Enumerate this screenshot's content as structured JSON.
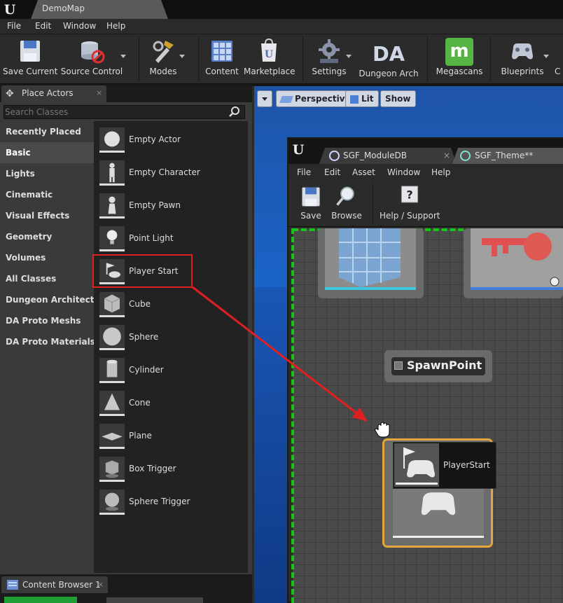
{
  "window": {
    "tab_title": "DemoMap"
  },
  "menu": {
    "items": [
      "File",
      "Edit",
      "Window",
      "Help"
    ]
  },
  "toolbar": {
    "buttons": [
      {
        "label": "Save Current",
        "icon": "save-icon"
      },
      {
        "label": "Source Control",
        "icon": "source-control-icon"
      },
      {
        "label": "Modes",
        "icon": "modes-icon"
      },
      {
        "label": "Content",
        "icon": "content-icon"
      },
      {
        "label": "Marketplace",
        "icon": "marketplace-icon"
      },
      {
        "label": "Settings",
        "icon": "settings-icon"
      },
      {
        "label": "Dungeon Arch",
        "icon": "dungeon-arch-icon"
      },
      {
        "label": "Megascans",
        "icon": "megascans-icon"
      },
      {
        "label": "Blueprints",
        "icon": "blueprints-icon"
      },
      {
        "label": "C",
        "icon": "cinematics-icon"
      }
    ],
    "dungeon_arch_logo": "DA",
    "megascans_logo": "m"
  },
  "place_actors": {
    "tab_label": "Place Actors",
    "close_glyph": "×",
    "search_placeholder": "Search Classes",
    "categories": [
      "Recently Placed",
      "Basic",
      "Lights",
      "Cinematic",
      "Visual Effects",
      "Geometry",
      "Volumes",
      "All Classes",
      "Dungeon Architect",
      "DA Proto Meshs",
      "DA Proto Materials"
    ],
    "selected_category": "Basic",
    "actors": [
      "Empty Actor",
      "Empty Character",
      "Empty Pawn",
      "Point Light",
      "Player Start",
      "Cube",
      "Sphere",
      "Cylinder",
      "Cone",
      "Plane",
      "Box Trigger",
      "Sphere Trigger"
    ],
    "highlighted_actor": "Player Start"
  },
  "content_browser": {
    "tab_label": "Content Browser 1",
    "close_glyph": "×"
  },
  "viewport": {
    "buttons": [
      "Perspective",
      "Lit",
      "Show"
    ]
  },
  "theme_editor": {
    "tabs": [
      {
        "label": "SGF_ModuleDB",
        "close": "×"
      },
      {
        "label": "SGF_Theme**"
      }
    ],
    "menu": [
      "File",
      "Edit",
      "Asset",
      "Window",
      "Help"
    ],
    "toolbar": [
      "Save",
      "Browse",
      "Help / Support"
    ],
    "help_glyph": "?",
    "nodes": {
      "spawn_point": "SpawnPoint",
      "player_start_tooltip": "PlayerStart"
    }
  },
  "colors": {
    "highlight": "#e02020",
    "graph_border": "#19c419",
    "selected_node": "#e3a63d",
    "viewport_sky": "#1a63c7"
  }
}
